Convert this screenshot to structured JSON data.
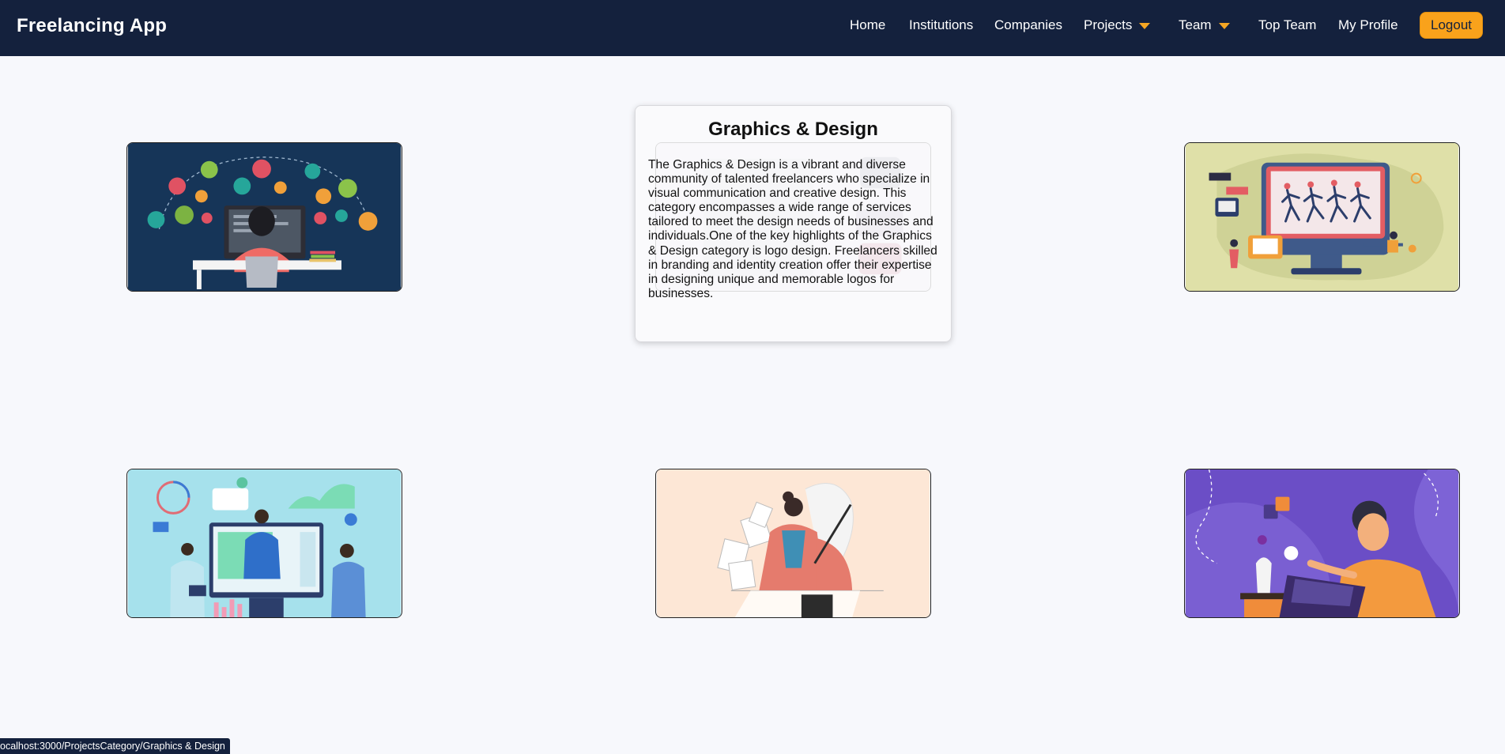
{
  "navbar": {
    "brand": "Freelancing App",
    "items": [
      {
        "label": "Home"
      },
      {
        "label": "Institutions"
      },
      {
        "label": "Companies"
      },
      {
        "label": "Projects"
      },
      {
        "label": "Team"
      },
      {
        "label": "Top Team"
      },
      {
        "label": "My Profile"
      }
    ],
    "logout_label": "Logout",
    "colors": {
      "background": "#14213d",
      "accent": "#f9a21b"
    }
  },
  "categories": [
    {
      "image": "web-development-illustration",
      "position": "top-left"
    },
    {
      "image": "graphics-design-illustration",
      "position": "top-center"
    },
    {
      "image": "video-animation-illustration",
      "position": "top-right"
    },
    {
      "image": "digital-marketing-illustration",
      "position": "bottom-left"
    },
    {
      "image": "writing-illustration",
      "position": "bottom-center"
    },
    {
      "image": "translation-illustration",
      "position": "bottom-right"
    }
  ],
  "popup": {
    "title": "Graphics & Design",
    "text": "The Graphics & Design is a vibrant and diverse community of talented freelancers who specialize in visual communication and creative design. This category encompasses a wide range of services tailored to meet the design needs of businesses and individuals.One of the key highlights of the Graphics & Design category is logo design. Freelancers skilled in branding and identity creation offer their expertise in designing unique and memorable logos for businesses."
  },
  "status_bar": {
    "url": "ocalhost:3000/ProjectsCategory/Graphics & Design"
  }
}
